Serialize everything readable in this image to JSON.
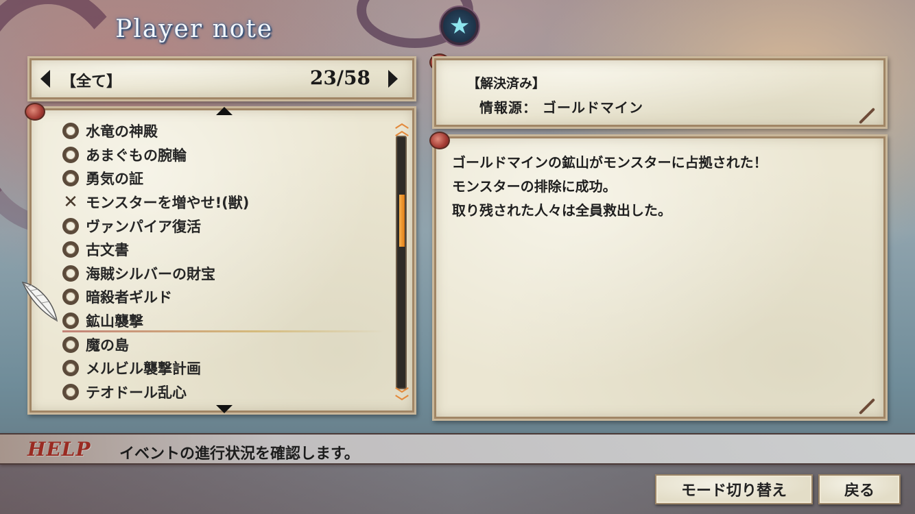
{
  "screen": {
    "title": "Player note"
  },
  "filter": {
    "label": "【全て】",
    "page_count": "23/58"
  },
  "events": [
    {
      "name": "水竜の神殿",
      "status": "circle"
    },
    {
      "name": "あまぐもの腕輪",
      "status": "circle"
    },
    {
      "name": "勇気の証",
      "status": "circle"
    },
    {
      "name": "モンスターを増やせ!(獣)",
      "status": "cross"
    },
    {
      "name": "ヴァンパイア復活",
      "status": "circle"
    },
    {
      "name": "古文書",
      "status": "circle"
    },
    {
      "name": "海賊シルバーの財宝",
      "status": "circle"
    },
    {
      "name": "暗殺者ギルド",
      "status": "circle"
    },
    {
      "name": "鉱山襲撃",
      "status": "circle",
      "selected": true
    },
    {
      "name": "魔の島",
      "status": "circle"
    },
    {
      "name": "メルビル襲撃計画",
      "status": "circle"
    },
    {
      "name": "テオドール乱心",
      "status": "circle"
    }
  ],
  "scrollbar": {
    "position": 0.29
  },
  "info": {
    "status": "【解決済み】",
    "source": "情報源： ゴールドマイン"
  },
  "detail": {
    "lines": [
      "ゴールドマインの鉱山がモンスターに占拠された！",
      "モンスターの排除に成功。",
      "取り残された人々は全員救出した。"
    ]
  },
  "help": {
    "label": "HELP",
    "text": "イベントの進行状況を確認します。"
  },
  "buttons": {
    "mode": "モード切り替え",
    "back": "戻る"
  },
  "icons": {
    "medal": "star-icon",
    "cursor": "feather-quill-icon"
  },
  "colors": {
    "scroll_accent": "#e07d17",
    "help_label": "#9a2b22",
    "medal_star": "#8fe6ef"
  }
}
